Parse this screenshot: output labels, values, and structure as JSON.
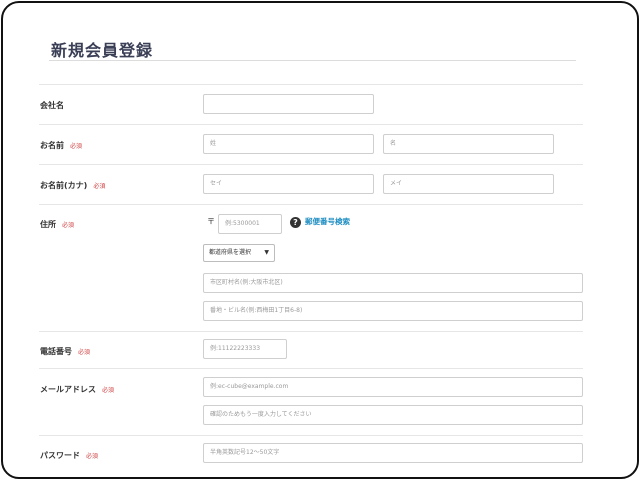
{
  "page": {
    "title": "新規会員登録"
  },
  "form": {
    "required_badge": "必須",
    "company": {
      "label": "会社名",
      "value": ""
    },
    "name": {
      "label": "お名前",
      "last_placeholder": "姓",
      "first_placeholder": "名"
    },
    "name_kana": {
      "label": "お名前(カナ)",
      "last_placeholder": "セイ",
      "first_placeholder": "メイ"
    },
    "address": {
      "label": "住所",
      "postal_mark": "〒",
      "postal_placeholder": "例:5300001",
      "help_icon_glyph": "?",
      "postal_search_link": "郵便番号検索",
      "prefecture_selected": "都道府県を選択",
      "city_placeholder": "市区町村名(例:大阪市北区)",
      "street_placeholder": "番地・ビル名(例:西梅田1丁目6-8)"
    },
    "phone": {
      "label": "電話番号",
      "placeholder": "例:11122223333"
    },
    "email": {
      "label": "メールアドレス",
      "placeholder": "例:ec-cube@example.com",
      "confirm_placeholder": "確認のためもう一度入力してください"
    },
    "password": {
      "label": "パスワード",
      "placeholder": "半角英数記号12〜50文字"
    }
  },
  "colors": {
    "title": "#3a3f56",
    "required": "#d04545",
    "link": "#1f8ec2"
  }
}
